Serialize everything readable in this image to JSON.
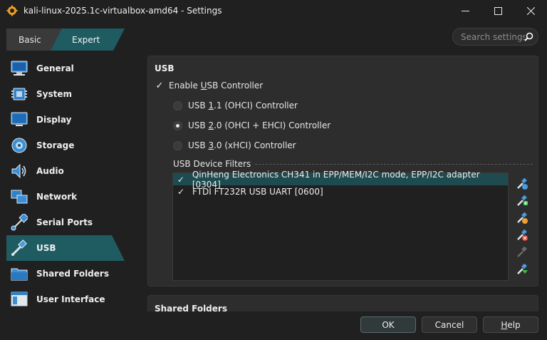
{
  "window": {
    "title": "kali-linux-2025.1c-virtualbox-amd64 - Settings",
    "controls": [
      "minimize",
      "maximize",
      "close"
    ]
  },
  "mode_tabs": {
    "basic": "Basic",
    "expert": "Expert",
    "selected": "expert"
  },
  "search": {
    "placeholder": "Search settings"
  },
  "sidebar": {
    "selected": "USB",
    "items": [
      {
        "label": "General",
        "icon": "monitor-icon"
      },
      {
        "label": "System",
        "icon": "chip-icon"
      },
      {
        "label": "Display",
        "icon": "display-icon"
      },
      {
        "label": "Storage",
        "icon": "disk-icon"
      },
      {
        "label": "Audio",
        "icon": "speaker-icon"
      },
      {
        "label": "Network",
        "icon": "network-icon"
      },
      {
        "label": "Serial Ports",
        "icon": "serial-port-icon"
      },
      {
        "label": "USB",
        "icon": "usb-icon"
      },
      {
        "label": "Shared Folders",
        "icon": "folder-icon"
      },
      {
        "label": "User Interface",
        "icon": "window-icon"
      }
    ]
  },
  "usb": {
    "section_title": "USB",
    "enable_label_pre": "Enable ",
    "enable_label_u": "U",
    "enable_label_post": "SB Controller",
    "enable_checked": true,
    "controllers": [
      {
        "pre": "USB ",
        "u": "1",
        "post": ".1 (OHCI) Controller",
        "checked": false
      },
      {
        "pre": "USB ",
        "u": "2",
        "post": ".0 (OHCI + EHCI) Controller",
        "checked": true
      },
      {
        "pre": "USB ",
        "u": "3",
        "post": ".0 (xHCI) Controller",
        "checked": false
      }
    ],
    "filters_label": "USB Device Filters",
    "filters": [
      {
        "label": "QinHeng Electronics CH341 in EPP/MEM/I2C mode, EPP/I2C adapter [0304]",
        "checked": true,
        "selected": true
      },
      {
        "label": "FTDI FT232R USB UART [0600]",
        "checked": true,
        "selected": false
      }
    ],
    "tools": [
      "add-filter-icon",
      "add-from-device-icon",
      "edit-filter-icon",
      "remove-filter-icon",
      "move-up-icon",
      "move-down-icon"
    ]
  },
  "next_section": {
    "title": "Shared Folders"
  },
  "footer": {
    "ok": "OK",
    "cancel": "Cancel",
    "help_u": "H",
    "help_post": "elp"
  },
  "colors": {
    "accent": "#1e5c62",
    "background": "#202020",
    "panel": "#2d2d2d"
  }
}
